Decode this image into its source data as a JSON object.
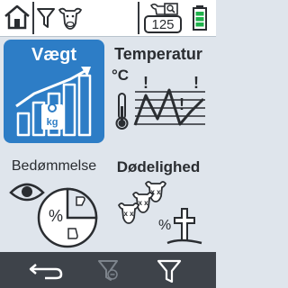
{
  "topbar": {
    "home_icon": "home-icon",
    "filter_icon": "filter-icon",
    "cow_icon": "cow-head-icon",
    "count": "125",
    "battery": "battery-icon",
    "battery_level": 0.75
  },
  "tiles": [
    {
      "label": "Vægt",
      "icon": "weight-chart-icon",
      "selected": true
    },
    {
      "label": "Temperatur",
      "unit": "°C",
      "icon": "temperature-chart-icon",
      "selected": false
    },
    {
      "label": "Bedømmelse",
      "icon": "evaluation-icon",
      "percent": "%",
      "selected": false
    },
    {
      "label": "Dødelighed",
      "icon": "mortality-icon",
      "percent": "%",
      "selected": false
    }
  ],
  "bottombar": {
    "back": "back-icon",
    "filter_clear": "filter-clear-icon",
    "filter": "filter-icon"
  },
  "colors": {
    "accent": "#2d7dc6",
    "bar": "#3e434a",
    "bg": "#dfe5ec",
    "battery": "#1fb24b"
  }
}
